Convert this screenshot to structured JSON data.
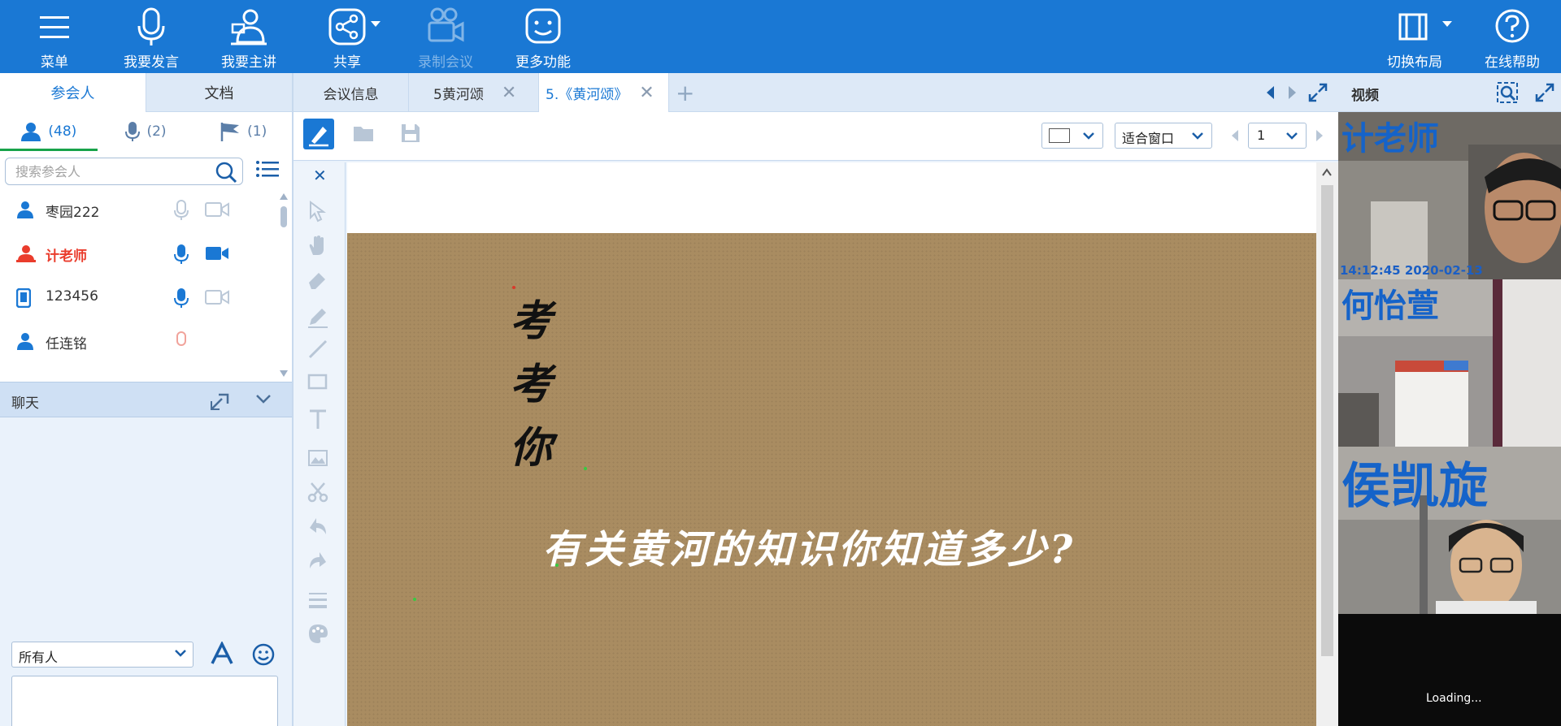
{
  "toolbar": {
    "menu": "菜单",
    "speak": "我要发言",
    "present": "我要主讲",
    "share": "共享",
    "record": "录制会议",
    "more": "更多功能",
    "layout": "切换布局",
    "help": "在线帮助"
  },
  "left_panel": {
    "tabs": [
      "参会人",
      "文档"
    ],
    "stats": {
      "participants": "(48)",
      "speakers": "(2)",
      "hands": "(1)"
    },
    "search_placeholder": "搜索参会人",
    "participants": [
      {
        "name": "枣园222",
        "role": "attendee"
      },
      {
        "name": "计老师",
        "role": "host"
      },
      {
        "name": "123456",
        "role": "mobile"
      },
      {
        "name": "任连铭",
        "role": "attendee"
      }
    ],
    "chat_title": "聊天",
    "chat_to": "所有人"
  },
  "center": {
    "tabs": [
      {
        "label": "会议信息"
      },
      {
        "label": "5黄河颂"
      },
      {
        "label": "5.《黄河颂》"
      }
    ],
    "fit_mode": "适合窗口",
    "page": "1",
    "slide": {
      "title_chars": [
        "考",
        "考",
        "你"
      ],
      "subtitle": "有关黄河的知识你知道多少?",
      "background": "#a98c61"
    }
  },
  "video_panel": {
    "title": "视频",
    "feeds": [
      {
        "name": "计老师",
        "timestamp": "14:12:45 2020-02-13"
      },
      {
        "name": "何怡萱"
      },
      {
        "name": "侯凯旋"
      }
    ],
    "loading": "Loading..."
  },
  "colors": {
    "toolbar_blue": "#1a78d4",
    "host_red": "#ea3c2c",
    "accent_green": "#18a34a"
  }
}
